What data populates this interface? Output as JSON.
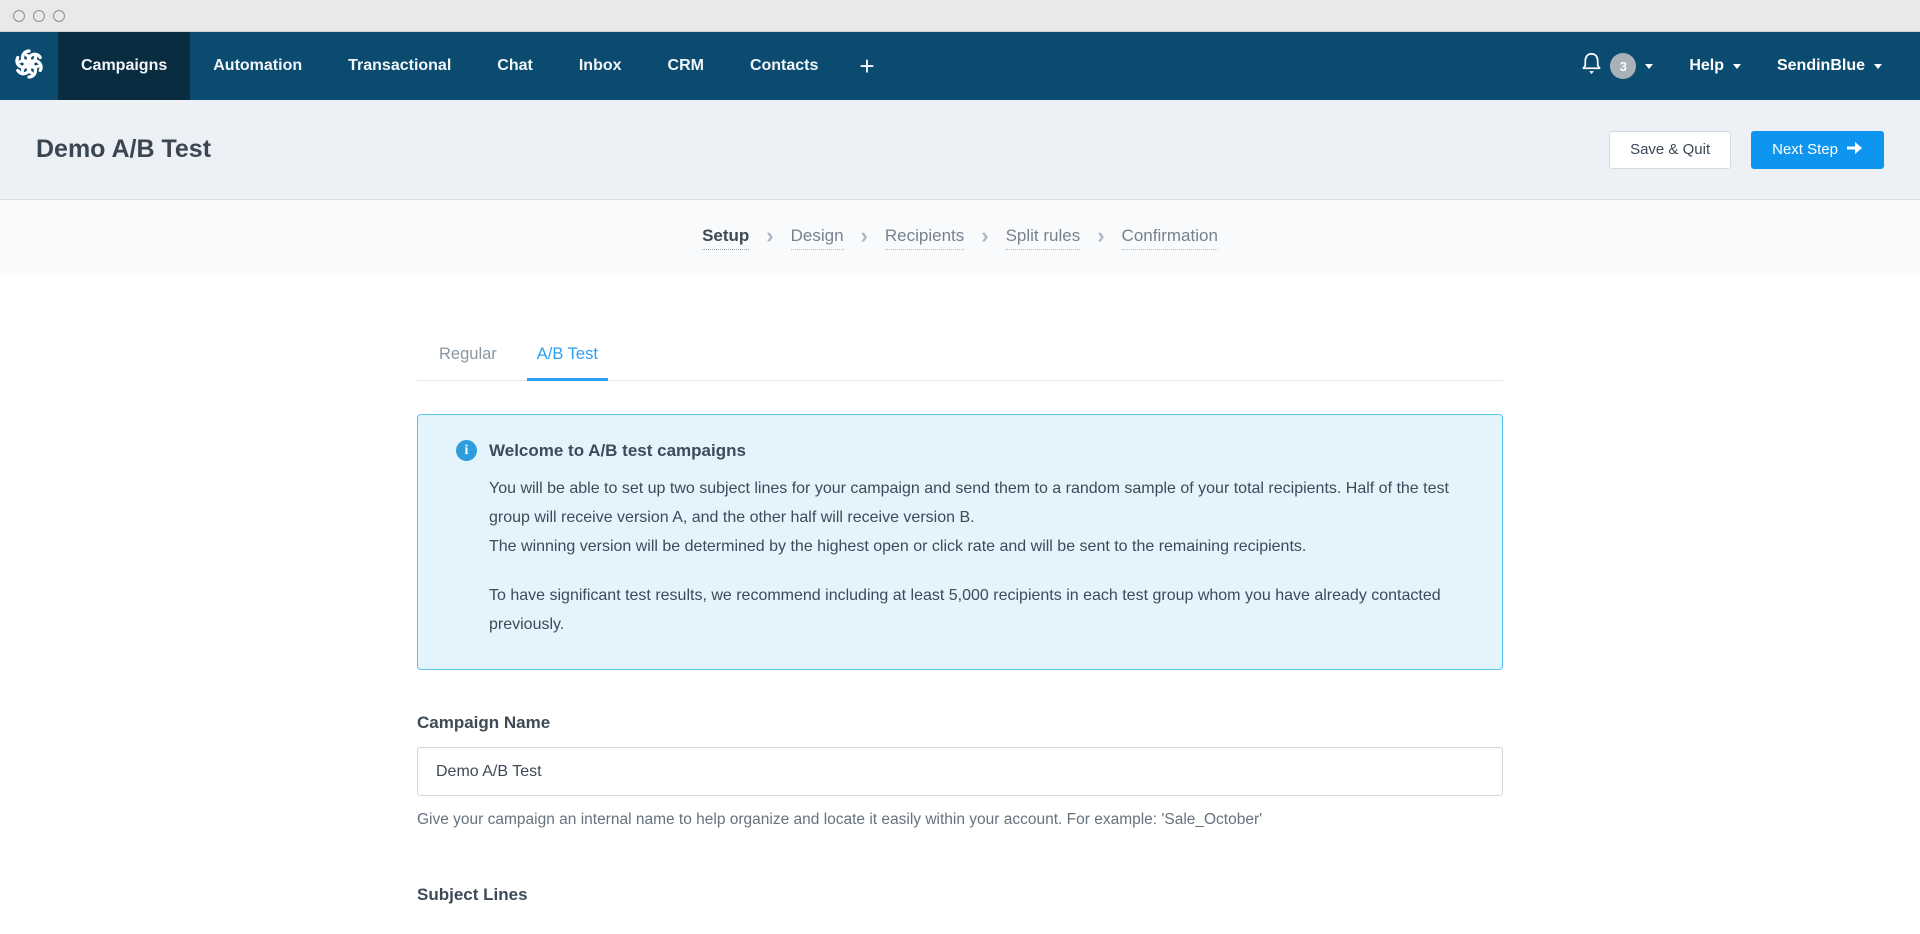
{
  "nav": {
    "items": [
      {
        "label": "Campaigns",
        "active": true
      },
      {
        "label": "Automation",
        "active": false
      },
      {
        "label": "Transactional",
        "active": false
      },
      {
        "label": "Chat",
        "active": false
      },
      {
        "label": "Inbox",
        "active": false
      },
      {
        "label": "CRM",
        "active": false
      },
      {
        "label": "Contacts",
        "active": false
      }
    ],
    "add_label": "+",
    "notification_count": "3",
    "help_label": "Help",
    "account_label": "SendinBlue"
  },
  "header": {
    "title": "Demo A/B Test",
    "save_quit_label": "Save & Quit",
    "next_step_label": "Next Step"
  },
  "stepper": {
    "steps": [
      {
        "label": "Setup",
        "active": true
      },
      {
        "label": "Design",
        "active": false
      },
      {
        "label": "Recipients",
        "active": false
      },
      {
        "label": "Split rules",
        "active": false
      },
      {
        "label": "Confirmation",
        "active": false
      }
    ]
  },
  "tabs": [
    {
      "label": "Regular",
      "active": false
    },
    {
      "label": "A/B Test",
      "active": true
    }
  ],
  "info_box": {
    "title": "Welcome to A/B test campaigns",
    "paragraph1": "You will be able to set up two subject lines for your campaign and send them to a random sample of your total recipients. Half of the test group will receive version A, and the other half will receive version B.",
    "paragraph2": "The winning version will be determined by the highest open or click rate and will be sent to the remaining recipients.",
    "paragraph3": "To have significant test results, we recommend including at least 5,000 recipients in each test group whom you have already contacted previously."
  },
  "campaign_name": {
    "label": "Campaign Name",
    "value": "Demo A/B Test",
    "helper": "Give your campaign an internal name to help organize and locate it easily within your account. For example: 'Sale_October'"
  },
  "subject_lines": {
    "label": "Subject Lines"
  },
  "colors": {
    "nav_bg": "#0c4b70",
    "nav_active_bg": "#0a2c40",
    "accent_blue": "#0d95f0",
    "tab_blue": "#2b9ff2",
    "info_bg": "#e4f4fd",
    "info_border": "#58c5f0",
    "header_bg": "#edf0f4"
  }
}
